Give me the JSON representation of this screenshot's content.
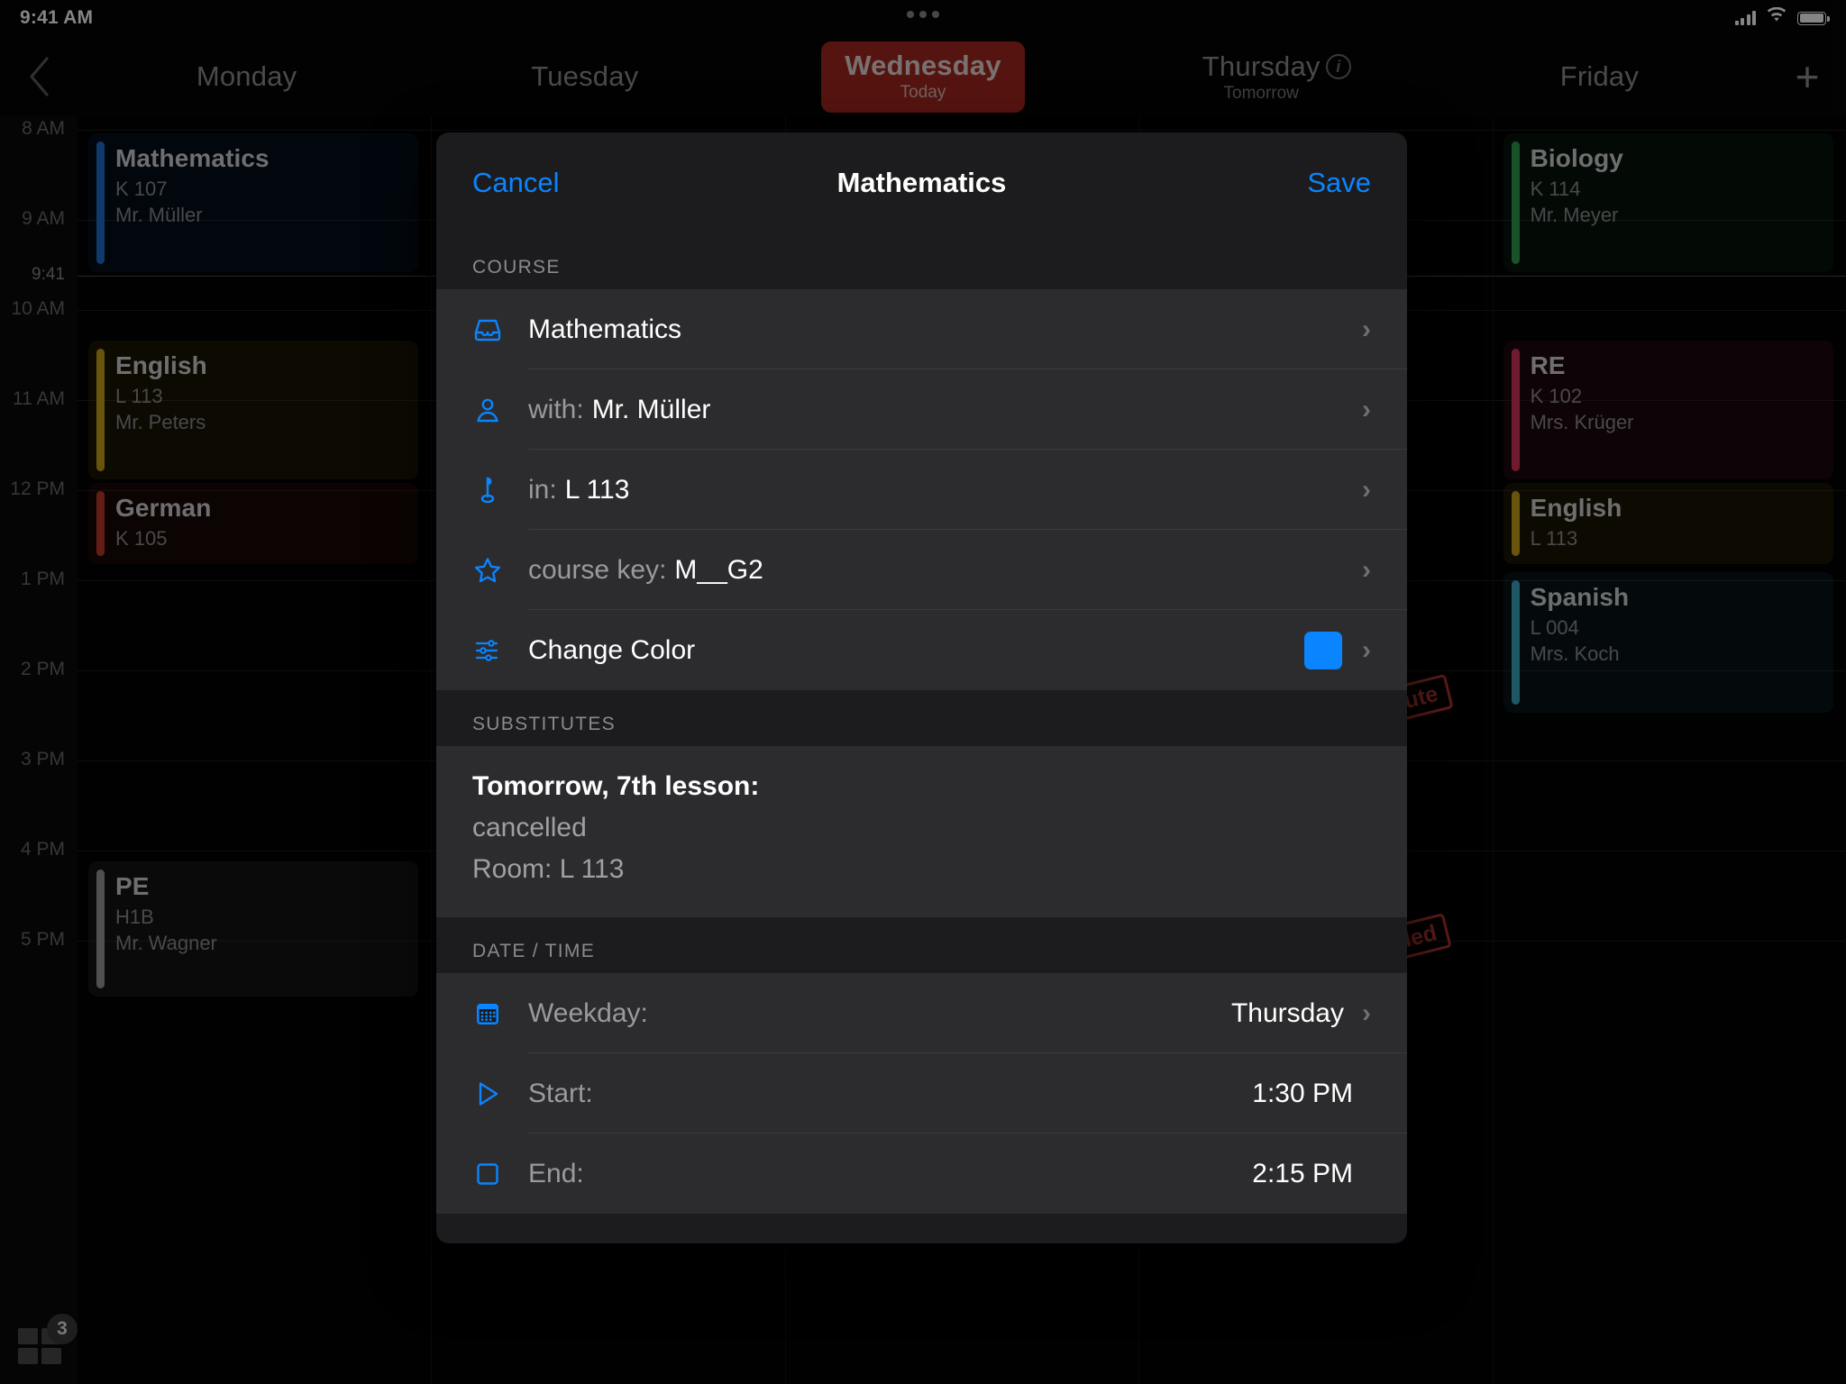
{
  "status_bar": {
    "time": "9:41 AM",
    "signal_icon": "cellular-signal-icon",
    "wifi_icon": "wifi-icon",
    "battery_icon": "battery-icon"
  },
  "multitask_dots": "multitasking-handle-icon",
  "day_header": {
    "back_icon": "chevron-left-icon",
    "add_icon": "plus-icon",
    "info_icon": "info-icon",
    "days": [
      {
        "name": "Monday",
        "sub": "",
        "today": false
      },
      {
        "name": "Tuesday",
        "sub": "",
        "today": false
      },
      {
        "name": "Wednesday",
        "sub": "Today",
        "today": true
      },
      {
        "name": "Thursday",
        "sub": "Tomorrow",
        "today": false
      },
      {
        "name": "Friday",
        "sub": "",
        "today": false
      }
    ]
  },
  "timetable": {
    "hour_labels": [
      "8 AM",
      "9 AM",
      "10 AM",
      "11 AM",
      "12 PM",
      "1 PM",
      "2 PM",
      "3 PM",
      "4 PM",
      "5 PM"
    ],
    "now_label": "9:41",
    "events": [
      {
        "title": "Mathematics",
        "room": "K 107",
        "teacher": "Mr. Müller",
        "color": "#1f6fd0",
        "day": 0
      },
      {
        "title": "English",
        "room": "L 113",
        "teacher": "Mr. Peters",
        "color": "#c9a21a",
        "day": 0
      },
      {
        "title": "German",
        "room": "K 105",
        "teacher": "",
        "color": "#c0392b",
        "day": 0
      },
      {
        "title": "PE",
        "room": "H1B",
        "teacher": "Mr. Wagner",
        "color": "#9a9a9e",
        "day": 0
      },
      {
        "title": "Biology",
        "room": "K 114",
        "teacher": "Mr. Meyer",
        "color": "#2f9e4f",
        "day": 4
      },
      {
        "title": "RE",
        "room": "K 102",
        "teacher": "Mrs. Krüger",
        "color": "#d6335c",
        "day": 4
      },
      {
        "title": "English",
        "room": "L 113",
        "teacher": "",
        "color": "#c9a21a",
        "day": 4
      },
      {
        "title": "Spanish",
        "room": "L 004",
        "teacher": "Mrs. Koch",
        "color": "#3aa8c1",
        "day": 4
      }
    ],
    "stamps": [
      "ute",
      "led"
    ]
  },
  "modal": {
    "cancel_label": "Cancel",
    "title": "Mathematics",
    "save_label": "Save",
    "course_section": {
      "header": "COURSE",
      "rows": [
        {
          "icon": "tray-icon",
          "label": "",
          "value": "Mathematics",
          "type": "chevron"
        },
        {
          "icon": "person-icon",
          "label": "with:",
          "value": "Mr. Müller",
          "type": "chevron"
        },
        {
          "icon": "pin-icon",
          "label": "in:",
          "value": "L 113",
          "type": "chevron"
        },
        {
          "icon": "star-icon",
          "label": "course key:",
          "value": "M__G2",
          "type": "chevron"
        },
        {
          "icon": "sliders-icon",
          "label": "Change Color",
          "value": "",
          "type": "color",
          "color": "#0a84ff"
        }
      ]
    },
    "substitutes_section": {
      "header": "SUBSTITUTES",
      "title": "Tomorrow, 7th lesson:",
      "lines": [
        "cancelled",
        "Room: L 113"
      ]
    },
    "datetime_section": {
      "header": "DATE / TIME",
      "rows": [
        {
          "icon": "calendar-icon",
          "label": "Weekday:",
          "value": "Thursday",
          "chevron": true
        },
        {
          "icon": "play-icon",
          "label": "Start:",
          "value": "1:30 PM",
          "chevron": false
        },
        {
          "icon": "stop-icon",
          "label": "End:",
          "value": "2:15 PM",
          "chevron": false
        }
      ]
    }
  },
  "dock": {
    "icon": "app-switcher-icon",
    "badge": "3"
  }
}
